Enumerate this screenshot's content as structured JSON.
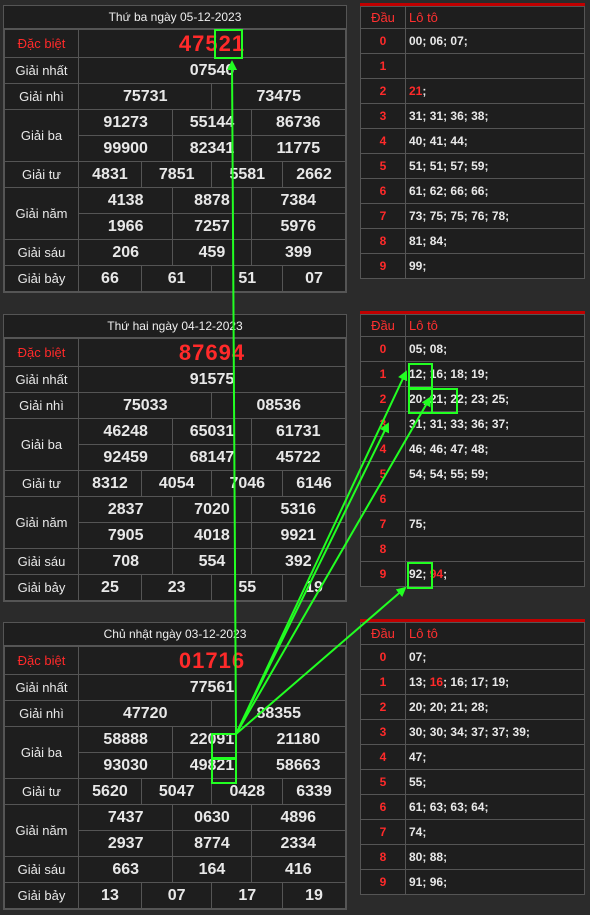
{
  "results": [
    {
      "date_title": "Thứ ba ngày 05-12-2023",
      "rows": [
        {
          "label": "Đặc biệt",
          "values": [
            "47521"
          ]
        },
        {
          "label": "Giải nhất",
          "values": [
            "07540"
          ]
        },
        {
          "label": "Giải nhì",
          "values": [
            "75731",
            "73475"
          ]
        },
        {
          "label": "Giải ba",
          "values": [
            [
              "91273",
              "55144",
              "86736"
            ],
            [
              "99900",
              "82341",
              "11775"
            ]
          ]
        },
        {
          "label": "Giải tư",
          "values": [
            "4831",
            "7851",
            "5581",
            "2662"
          ]
        },
        {
          "label": "Giải năm",
          "values": [
            [
              "4138",
              "8878",
              "7384"
            ],
            [
              "1966",
              "7257",
              "5976"
            ]
          ]
        },
        {
          "label": "Giải sáu",
          "values": [
            "206",
            "459",
            "399"
          ]
        },
        {
          "label": "Giải bảy",
          "values": [
            "66",
            "61",
            "51",
            "07"
          ]
        }
      ]
    },
    {
      "date_title": "Thứ hai ngày 04-12-2023",
      "rows": [
        {
          "label": "Đặc biệt",
          "values": [
            "87694"
          ]
        },
        {
          "label": "Giải nhất",
          "values": [
            "91575"
          ]
        },
        {
          "label": "Giải nhì",
          "values": [
            "75033",
            "08536"
          ]
        },
        {
          "label": "Giải ba",
          "values": [
            [
              "46248",
              "65031",
              "61731"
            ],
            [
              "92459",
              "68147",
              "45722"
            ]
          ]
        },
        {
          "label": "Giải tư",
          "values": [
            "8312",
            "4054",
            "7046",
            "6146"
          ]
        },
        {
          "label": "Giải năm",
          "values": [
            [
              "2837",
              "7020",
              "5316"
            ],
            [
              "7905",
              "4018",
              "9921"
            ]
          ]
        },
        {
          "label": "Giải sáu",
          "values": [
            "708",
            "554",
            "392"
          ]
        },
        {
          "label": "Giải bảy",
          "values": [
            "25",
            "23",
            "55",
            "19"
          ]
        }
      ]
    },
    {
      "date_title": "Chủ nhật ngày 03-12-2023",
      "rows": [
        {
          "label": "Đặc biệt",
          "values": [
            "01716"
          ]
        },
        {
          "label": "Giải nhất",
          "values": [
            "77561"
          ]
        },
        {
          "label": "Giải nhì",
          "values": [
            "47720",
            "88355"
          ]
        },
        {
          "label": "Giải ba",
          "values": [
            [
              "58888",
              "22091",
              "21180"
            ],
            [
              "93030",
              "49821",
              "58663"
            ]
          ]
        },
        {
          "label": "Giải tư",
          "values": [
            "5620",
            "5047",
            "0428",
            "6339"
          ]
        },
        {
          "label": "Giải năm",
          "values": [
            [
              "7437",
              "0630",
              "4896"
            ],
            [
              "2937",
              "8774",
              "2334"
            ]
          ]
        },
        {
          "label": "Giải sáu",
          "values": [
            "663",
            "164",
            "416"
          ]
        },
        {
          "label": "Giải bảy",
          "values": [
            "13",
            "07",
            "17",
            "19"
          ]
        }
      ]
    }
  ],
  "loto": [
    {
      "header_dau": "Đầu",
      "header_loto": "Lô tô",
      "rows": [
        {
          "dau": "0",
          "items": [
            "00",
            "06",
            "07"
          ],
          "hl": []
        },
        {
          "dau": "1",
          "items": [],
          "hl": []
        },
        {
          "dau": "2",
          "items": [
            "21"
          ],
          "hl": [
            0
          ]
        },
        {
          "dau": "3",
          "items": [
            "31",
            "31",
            "36",
            "38"
          ],
          "hl": []
        },
        {
          "dau": "4",
          "items": [
            "40",
            "41",
            "44"
          ],
          "hl": []
        },
        {
          "dau": "5",
          "items": [
            "51",
            "51",
            "57",
            "59"
          ],
          "hl": []
        },
        {
          "dau": "6",
          "items": [
            "61",
            "62",
            "66",
            "66"
          ],
          "hl": []
        },
        {
          "dau": "7",
          "items": [
            "73",
            "75",
            "75",
            "76",
            "78"
          ],
          "hl": []
        },
        {
          "dau": "8",
          "items": [
            "81",
            "84"
          ],
          "hl": []
        },
        {
          "dau": "9",
          "items": [
            "99"
          ],
          "hl": []
        }
      ]
    },
    {
      "header_dau": "Đầu",
      "header_loto": "Lô tô",
      "rows": [
        {
          "dau": "0",
          "items": [
            "05",
            "08"
          ],
          "hl": []
        },
        {
          "dau": "1",
          "items": [
            "12",
            "16",
            "18",
            "19"
          ],
          "hl": []
        },
        {
          "dau": "2",
          "items": [
            "20",
            "21",
            "22",
            "23",
            "25"
          ],
          "hl": []
        },
        {
          "dau": "3",
          "items": [
            "31",
            "31",
            "33",
            "36",
            "37"
          ],
          "hl": []
        },
        {
          "dau": "4",
          "items": [
            "46",
            "46",
            "47",
            "48"
          ],
          "hl": []
        },
        {
          "dau": "5",
          "items": [
            "54",
            "54",
            "55",
            "59"
          ],
          "hl": []
        },
        {
          "dau": "6",
          "items": [],
          "hl": []
        },
        {
          "dau": "7",
          "items": [
            "75"
          ],
          "hl": []
        },
        {
          "dau": "8",
          "items": [],
          "hl": []
        },
        {
          "dau": "9",
          "items": [
            "92",
            "94"
          ],
          "hl": [
            1
          ]
        }
      ]
    },
    {
      "header_dau": "Đầu",
      "header_loto": "Lô tô",
      "rows": [
        {
          "dau": "0",
          "items": [
            "07"
          ],
          "hl": []
        },
        {
          "dau": "1",
          "items": [
            "13",
            "16",
            "16",
            "17",
            "19"
          ],
          "hl": [
            1
          ]
        },
        {
          "dau": "2",
          "items": [
            "20",
            "20",
            "21",
            "28"
          ],
          "hl": []
        },
        {
          "dau": "3",
          "items": [
            "30",
            "30",
            "34",
            "37",
            "37",
            "39"
          ],
          "hl": []
        },
        {
          "dau": "4",
          "items": [
            "47"
          ],
          "hl": []
        },
        {
          "dau": "5",
          "items": [
            "55"
          ],
          "hl": []
        },
        {
          "dau": "6",
          "items": [
            "61",
            "63",
            "63",
            "64"
          ],
          "hl": []
        },
        {
          "dau": "7",
          "items": [
            "74"
          ],
          "hl": []
        },
        {
          "dau": "8",
          "items": [
            "80",
            "88"
          ],
          "hl": []
        },
        {
          "dau": "9",
          "items": [
            "91",
            "96"
          ],
          "hl": []
        }
      ]
    }
  ],
  "colors": {
    "accent_red": "#ff2a2a",
    "highlight_green": "#22ff22",
    "header_red": "#c00000"
  }
}
